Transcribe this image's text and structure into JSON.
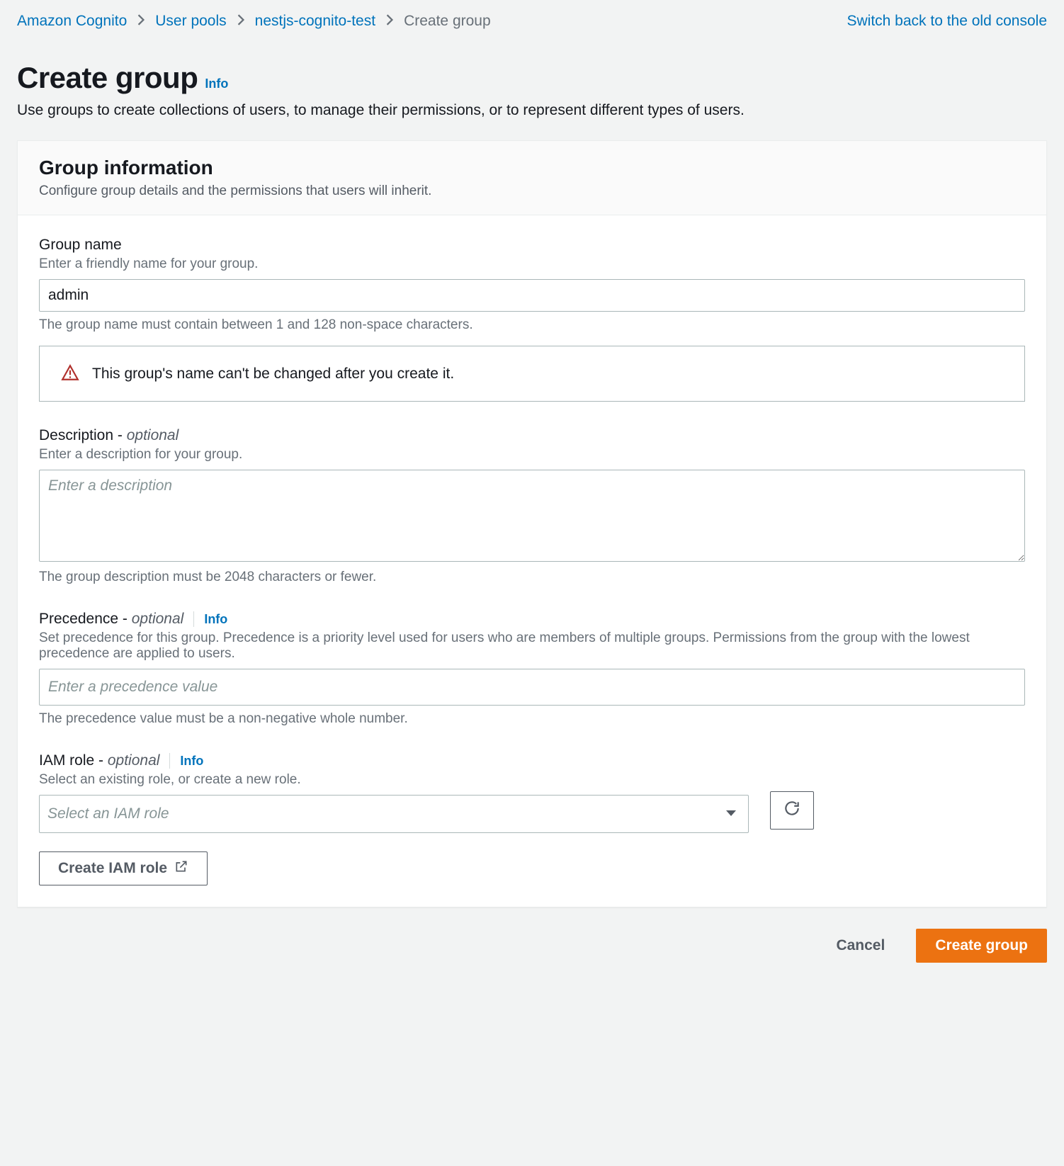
{
  "top": {
    "switch_link": "Switch back to the old console"
  },
  "breadcrumbs": {
    "items": [
      {
        "label": "Amazon Cognito"
      },
      {
        "label": "User pools"
      },
      {
        "label": "nestjs-cognito-test"
      },
      {
        "label": "Create group"
      }
    ]
  },
  "header": {
    "title": "Create group",
    "info": "Info",
    "description": "Use groups to create collections of users, to manage their permissions, or to represent different types of users."
  },
  "panel": {
    "title": "Group information",
    "subtitle": "Configure group details and the permissions that users will inherit."
  },
  "group_name": {
    "label": "Group name",
    "help": "Enter a friendly name for your group.",
    "value": "admin",
    "constraint": "The group name must contain between 1 and 128 non-space characters.",
    "alert": "This group's name can't be changed after you create it."
  },
  "description": {
    "label": "Description",
    "optional": "optional",
    "help": "Enter a description for your group.",
    "placeholder": "Enter a description",
    "constraint": "The group description must be 2048 characters or fewer."
  },
  "precedence": {
    "label": "Precedence",
    "optional": "optional",
    "info": "Info",
    "help": "Set precedence for this group. Precedence is a priority level used for users who are members of multiple groups. Permissions from the group with the lowest precedence are applied to users.",
    "placeholder": "Enter a precedence value",
    "constraint": "The precedence value must be a non-negative whole number."
  },
  "iam_role": {
    "label": "IAM role",
    "optional": "optional",
    "info": "Info",
    "help": "Select an existing role, or create a new role.",
    "placeholder": "Select an IAM role",
    "create_button": "Create IAM role"
  },
  "footer": {
    "cancel": "Cancel",
    "submit": "Create group"
  },
  "misc": {
    "sep": " - "
  }
}
